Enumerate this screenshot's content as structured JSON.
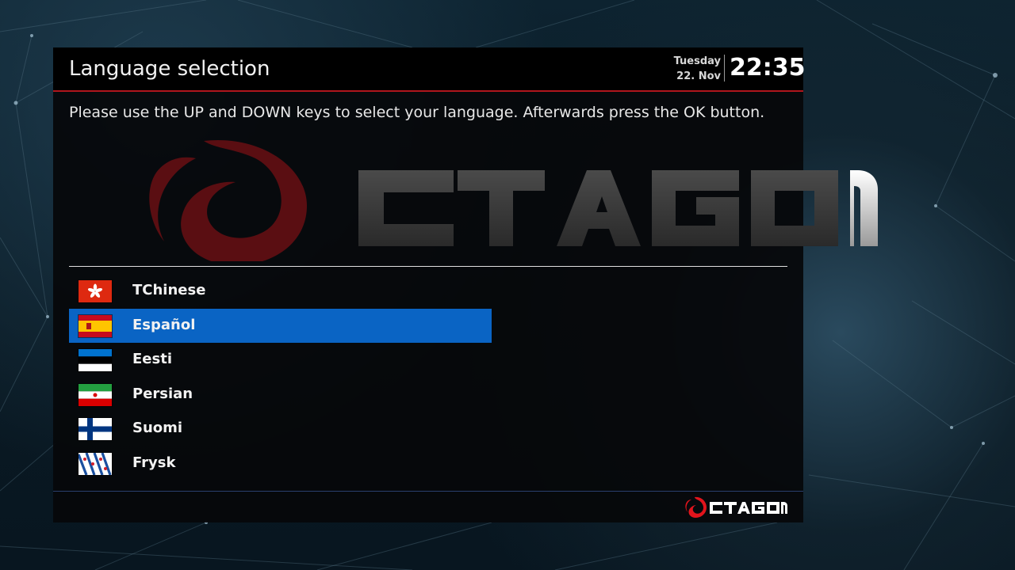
{
  "header": {
    "title": "Language selection",
    "day": "Tuesday",
    "date": "22. Nov",
    "time": "22:35"
  },
  "instruction": "Please use the UP and DOWN keys to select your language. Afterwards press the OK button.",
  "brand": {
    "name": "CTAGON",
    "logo_red": "#b0161d",
    "watermark_text_color": "#3a3a3a"
  },
  "languages": [
    {
      "label": "TChinese",
      "flag": "hongkong-flag-icon"
    },
    {
      "label": "Español",
      "flag": "spain-flag-icon"
    },
    {
      "label": "Eesti",
      "flag": "estonia-flag-icon"
    },
    {
      "label": "Persian",
      "flag": "iran-flag-icon"
    },
    {
      "label": "Suomi",
      "flag": "finland-flag-icon"
    },
    {
      "label": "Frysk",
      "flag": "friesland-flag-icon"
    }
  ],
  "selected_index": 1,
  "colors": {
    "selection": "#0a64c4",
    "header_accent": "#b0161d",
    "footer_accent": "#2a3f6e"
  }
}
